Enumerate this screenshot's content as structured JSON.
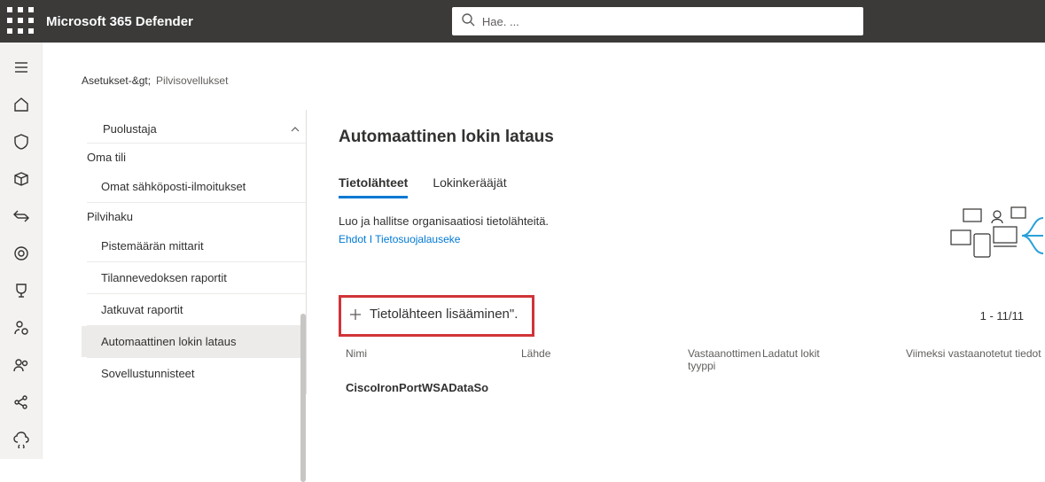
{
  "header": {
    "app_title": "Microsoft 365 Defender",
    "search_placeholder": "Hae. ..."
  },
  "breadcrumb": {
    "parent": "Asetukset-&gt;",
    "current": "Pilvisovellukset"
  },
  "settings_nav": {
    "item_defender": "Puolustaja",
    "group_account": "Oma tili",
    "item_email_notifications": "Omat sähköposti-ilmoitukset",
    "group_cloud_discovery": "Pilvihaku",
    "item_score_metrics": "Pistemäärän mittarit",
    "item_snapshot_reports": "Tilannevedoksen raportit",
    "item_continuous_reports": "Jatkuvat raportit",
    "item_auto_log_upload": "Automaattinen lokin lataus",
    "item_app_tags": "Sovellustunnisteet"
  },
  "main": {
    "title": "Automaattinen lokin lataus",
    "tabs": {
      "data_sources": "Tietolähteet",
      "log_collectors": "Lokinkerääjät"
    },
    "description": "Luo ja hallitse organisaatiosi tietolähteitä.",
    "links": {
      "terms": "Ehdot",
      "privacy": "Tietosuojalauseke",
      "sep": " I "
    },
    "add_button": "Tietolähteen lisääminen\".",
    "pager": "1 - 11/11",
    "columns": {
      "name": "Nimi",
      "source": "Lähde",
      "receiver_type": "Vastaanottimen tyyppi",
      "uploaded_logs": "Ladatut lokit",
      "last_received": "Viimeksi vastaanotetut tiedot"
    },
    "rows": [
      {
        "name": "CiscoIronPortWSADataSo"
      }
    ]
  }
}
